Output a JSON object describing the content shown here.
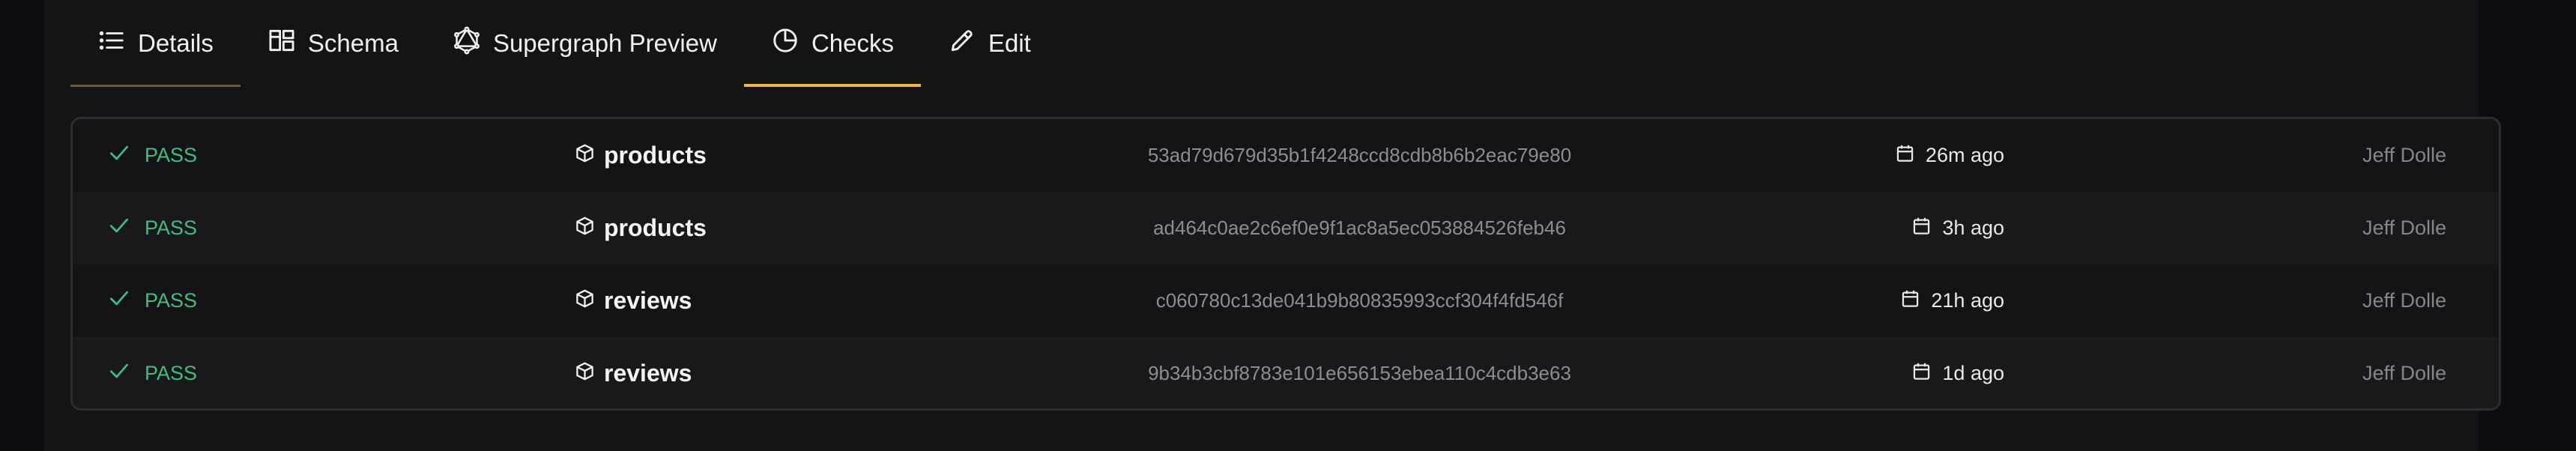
{
  "tabs": [
    {
      "label": "Details",
      "icon": "list-icon"
    },
    {
      "label": "Schema",
      "icon": "schema-icon"
    },
    {
      "label": "Supergraph Preview",
      "icon": "graphql-icon"
    },
    {
      "label": "Checks",
      "icon": "pie-chart-icon"
    },
    {
      "label": "Edit",
      "icon": "pencil-icon"
    }
  ],
  "active_tab": "Checks",
  "colors": {
    "accent": "#f5b63d",
    "pass": "#3fbf7f",
    "background": "#141416"
  },
  "checks": [
    {
      "status": "PASS",
      "subgraph": "products",
      "hash": "53ad79d679d35b1f4248ccd8cdb8b6b2eac79e80",
      "time": "26m ago",
      "author": "Jeff Dolle"
    },
    {
      "status": "PASS",
      "subgraph": "products",
      "hash": "ad464c0ae2c6ef0e9f1ac8a5ec053884526feb46",
      "time": "3h ago",
      "author": "Jeff Dolle"
    },
    {
      "status": "PASS",
      "subgraph": "reviews",
      "hash": "c060780c13de041b9b80835993ccf304f4fd546f",
      "time": "21h ago",
      "author": "Jeff Dolle"
    },
    {
      "status": "PASS",
      "subgraph": "reviews",
      "hash": "9b34b3cbf8783e101e656153ebea110c4cdb3e63",
      "time": "1d ago",
      "author": "Jeff Dolle"
    }
  ]
}
